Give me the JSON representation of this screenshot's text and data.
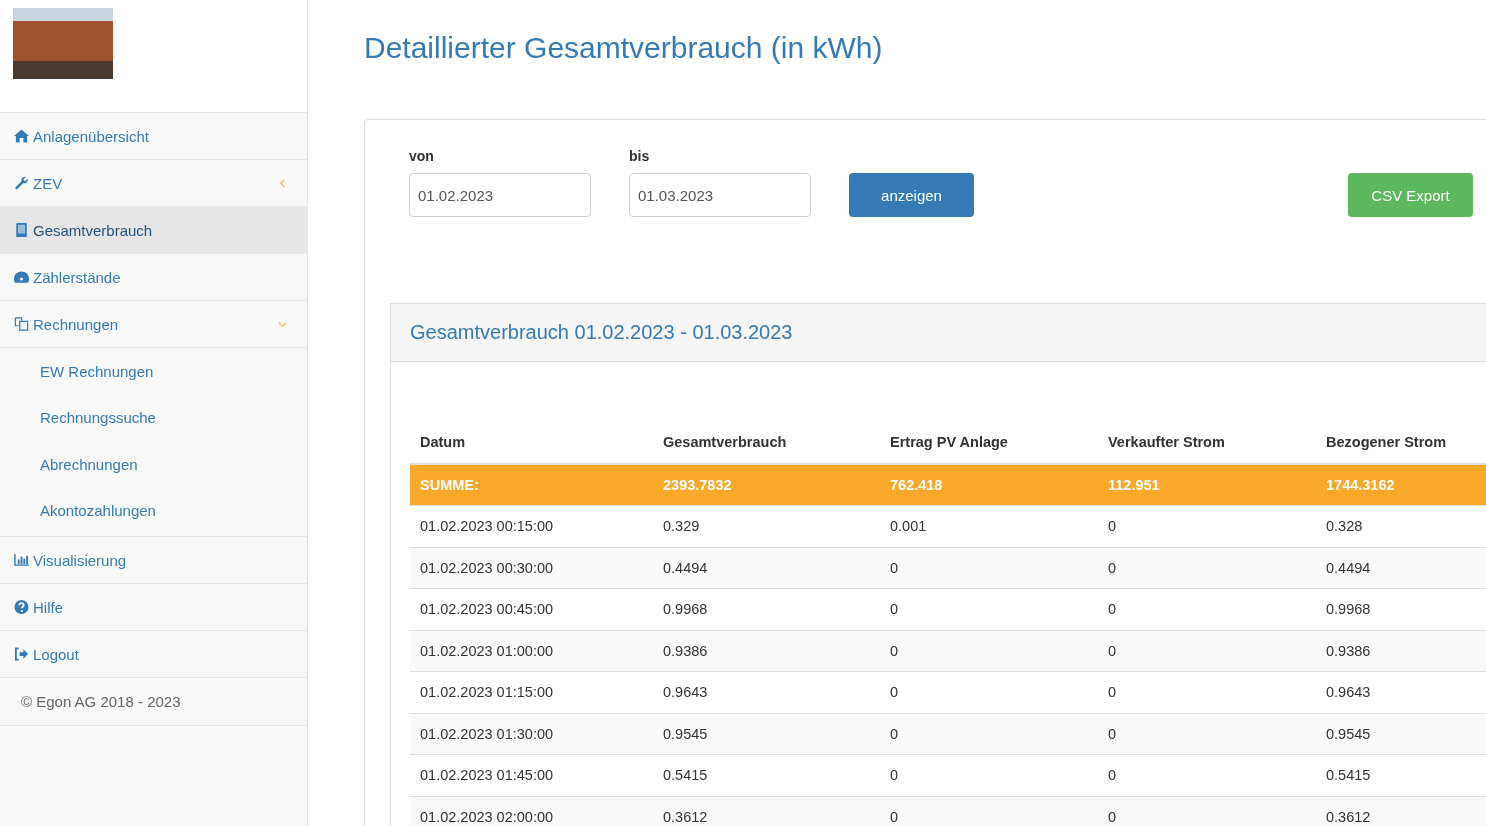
{
  "sidebar": {
    "items": [
      {
        "kind": "link",
        "label": "Anlagenübersicht",
        "selected": false
      },
      {
        "kind": "group",
        "label": "ZEV",
        "selected": false,
        "expanded": false
      },
      {
        "kind": "link",
        "label": "Gesamtverbrauch",
        "selected": true
      },
      {
        "kind": "link",
        "label": "Zählerstände",
        "selected": false
      },
      {
        "kind": "group",
        "label": "Rechnungen",
        "selected": false,
        "expanded": true,
        "children": [
          {
            "label": "EW Rechnungen",
            "selected": false
          },
          {
            "label": "Rechnungssuche",
            "selected": false
          },
          {
            "label": "Abrechnungen",
            "selected": false
          },
          {
            "label": "Akontozahlungen",
            "selected": false
          }
        ]
      },
      {
        "kind": "link",
        "label": "Visualisierung",
        "selected": false
      },
      {
        "kind": "link",
        "label": "Hilfe",
        "selected": false
      },
      {
        "kind": "link",
        "label": "Logout",
        "selected": false
      }
    ],
    "footer": "© Egon AG 2018 - 2023"
  },
  "title": "Detaillierter Gesamtverbrauch (in kWh)",
  "filter": {
    "from": {
      "label": "von",
      "value": "01.02.2023"
    },
    "to": {
      "label": "bis",
      "value": "01.03.2023"
    },
    "show_button": "anzeigen",
    "export_button": "CSV Export"
  },
  "result": {
    "heading": "Gesamtverbrauch 01.02.2023 - 01.03.2023",
    "table": {
      "columns": [
        "Datum",
        "Gesamtverbrauch",
        "Ertrag PV Anlage",
        "Verkaufter Strom",
        "Bezogener Strom"
      ],
      "total": [
        "SUMME:",
        "2393.7832",
        "762.418",
        "112.951",
        "1744.3162"
      ],
      "rows": [
        [
          "01.02.2023 00:15:00",
          "0.329",
          "0.001",
          "0",
          "0.328"
        ],
        [
          "01.02.2023 00:30:00",
          "0.4494",
          "0",
          "0",
          "0.4494"
        ],
        [
          "01.02.2023 00:45:00",
          "0.9968",
          "0",
          "0",
          "0.9968"
        ],
        [
          "01.02.2023 01:00:00",
          "0.9386",
          "0",
          "0",
          "0.9386"
        ],
        [
          "01.02.2023 01:15:00",
          "0.9643",
          "0",
          "0",
          "0.9643"
        ],
        [
          "01.02.2023 01:30:00",
          "0.9545",
          "0",
          "0",
          "0.9545"
        ],
        [
          "01.02.2023 01:45:00",
          "0.5415",
          "0",
          "0",
          "0.5415"
        ],
        [
          "01.02.2023 02:00:00",
          "0.3612",
          "0",
          "0",
          "0.3612"
        ]
      ]
    }
  }
}
